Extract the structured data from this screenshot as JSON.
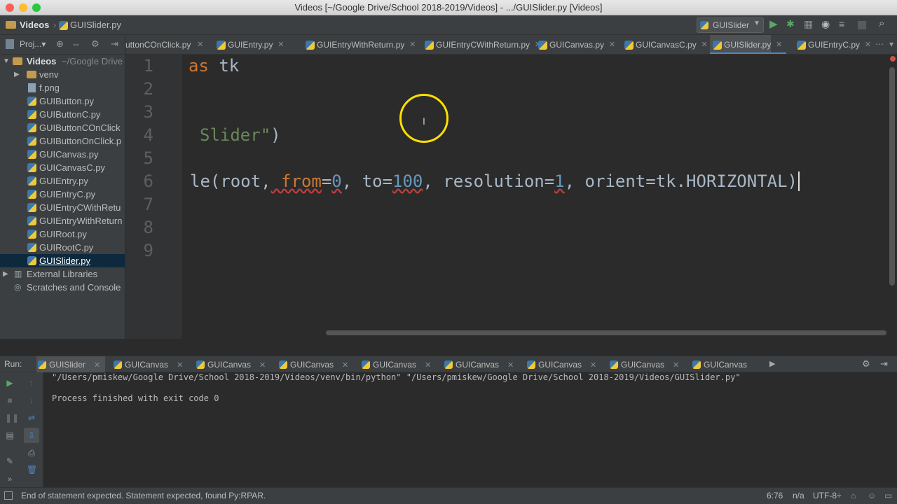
{
  "window": {
    "title": "Videos [~/Google Drive/School 2018-2019/Videos] - .../GUISlider.py [Videos]"
  },
  "navbar": {
    "crumb1": "Videos",
    "crumb2": "GUISlider.py",
    "run_config": "GUISlider"
  },
  "project_panel": {
    "header": "Proj...▾"
  },
  "tabs": [
    {
      "label": "uttonCOnClick.py",
      "active": false
    },
    {
      "label": "GUIEntry.py",
      "active": false
    },
    {
      "label": "GUIEntryWithReturn.py",
      "active": false
    },
    {
      "label": "GUIEntryCWithReturn.py",
      "active": false
    },
    {
      "label": "GUICanvas.py",
      "active": false
    },
    {
      "label": "GUICanvasC.py",
      "active": false
    },
    {
      "label": "GUISlider.py",
      "active": true
    },
    {
      "label": "GUIEntryC.py",
      "active": false
    }
  ],
  "tree": [
    {
      "label": "Videos",
      "extra": "~/Google Drive",
      "type": "root"
    },
    {
      "label": "venv",
      "type": "folder"
    },
    {
      "label": "f.png",
      "type": "file"
    },
    {
      "label": "GUIButton.py",
      "type": "py"
    },
    {
      "label": "GUIButtonC.py",
      "type": "py"
    },
    {
      "label": "GUIButtonCOnClick",
      "type": "py"
    },
    {
      "label": "GUIButtonOnClick.p",
      "type": "py"
    },
    {
      "label": "GUICanvas.py",
      "type": "py"
    },
    {
      "label": "GUICanvasC.py",
      "type": "py"
    },
    {
      "label": "GUIEntry.py",
      "type": "py"
    },
    {
      "label": "GUIEntryC.py",
      "type": "py"
    },
    {
      "label": "GUIEntryCWithRetu",
      "type": "py"
    },
    {
      "label": "GUIEntryWithReturn",
      "type": "py"
    },
    {
      "label": "GUIRoot.py",
      "type": "py"
    },
    {
      "label": "GUIRootC.py",
      "type": "py"
    },
    {
      "label": "GUISlider.py",
      "type": "py",
      "selected": true
    },
    {
      "label": "External Libraries",
      "type": "lib"
    },
    {
      "label": "Scratches and Console",
      "type": "scratch"
    }
  ],
  "line_numbers": [
    "1",
    "2",
    "3",
    "4",
    "5",
    "6",
    "7",
    "8",
    "9"
  ],
  "code": {
    "line1_kw": "as",
    "line1_rest": " tk",
    "line4_str": "Slider\"",
    "line4_rest": ")",
    "line6_a": "le(root,",
    "line6_b": " from",
    "line6_c": "=",
    "line6_d": "0",
    "line6_e": ",",
    "line6_f": " to=",
    "line6_g": "100",
    "line6_h": ",",
    "line6_i": " resolution=",
    "line6_j": "1",
    "line6_k": ",",
    "line6_l": " orient=tk.HORIZONTAL)"
  },
  "run": {
    "label": "Run:",
    "tabs": [
      "GUISlider",
      "GUICanvas",
      "GUICanvas",
      "GUICanvas",
      "GUICanvas",
      "GUICanvas",
      "GUICanvas",
      "GUICanvas",
      "GUICanvas"
    ],
    "cmd": "\"/Users/pmiskew/Google Drive/School 2018-2019/Videos/venv/bin/python\" \"/Users/pmiskew/Google Drive/School 2018-2019/Videos/GUISlider.py\"",
    "result": "Process finished with exit code 0"
  },
  "status": {
    "message": "End of statement expected. Statement expected, found Py:RPAR.",
    "position": "6:76",
    "na": "n/a",
    "encoding": "UTF-8÷"
  },
  "colors": {
    "accent": "#4a88c7",
    "cursor_ring": "#ffe000",
    "keyword": "#cc7832",
    "number": "#6897bb",
    "string": "#6a8759"
  }
}
